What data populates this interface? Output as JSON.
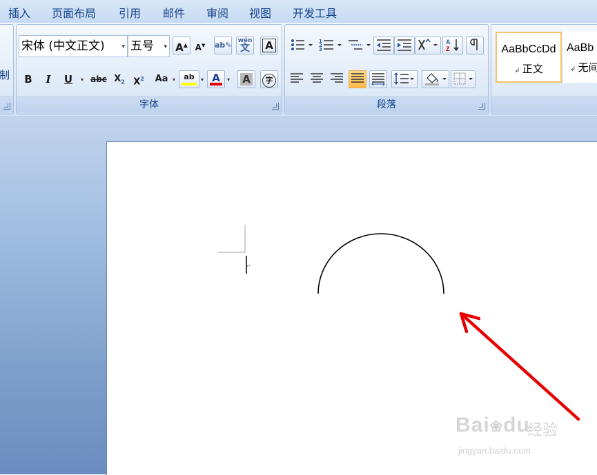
{
  "tabs": [
    "插入",
    "页面布局",
    "引用",
    "邮件",
    "审阅",
    "视图",
    "开发工具"
  ],
  "clipboard_fragment": "制",
  "font_group": {
    "font_name": "宋体 (中文正文)",
    "font_size": "五号",
    "label": "字体",
    "buttons": {
      "grow": "A",
      "shrink": "A",
      "phonetic": "wén",
      "phonetic_char": "文",
      "border_char": "A",
      "bold": "B",
      "italic": "I",
      "underline": "U",
      "strike": "abc",
      "subscript": "X",
      "superscript": "X",
      "change_case": "Aa",
      "highlight": "ab",
      "font_color": "A",
      "shading_char": "A",
      "enclose_char": "字"
    }
  },
  "paragraph_group": {
    "label": "段落"
  },
  "styles": [
    {
      "sample": "AaBbCcDd",
      "name": "正文"
    },
    {
      "sample": "AaBb",
      "name": "无间"
    }
  ],
  "watermark": {
    "brand": "Bai",
    "brand2": "du",
    "jingyan": "经验",
    "url": "jingyan.baidu.com"
  },
  "colors": {
    "highlight": "#ffff00",
    "font_color": "#e00000",
    "arrow": "#e60000",
    "selected_style_border": "#f2c36b",
    "ribbon_text": "#15428b"
  }
}
